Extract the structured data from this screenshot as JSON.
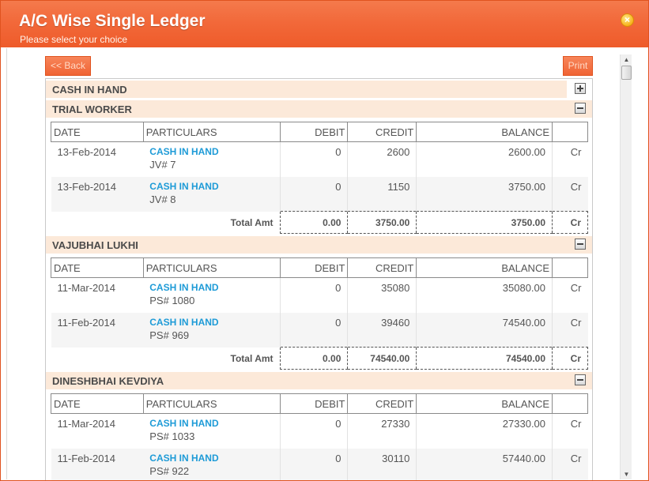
{
  "window": {
    "title": "A/C Wise Single Ledger",
    "subtitle": "Please select your choice",
    "close_icon": "close-icon"
  },
  "toolbar": {
    "back_label": "<< Back",
    "print_label": "Print"
  },
  "columns": [
    "DATE",
    "PARTICULARS",
    "DEBIT",
    "CREDIT",
    "BALANCE",
    ""
  ],
  "groups": [
    {
      "name": "CASH IN HAND",
      "state": "collapsed"
    },
    {
      "name": "TRIAL WORKER",
      "state": "expanded",
      "rows": [
        {
          "date": "13-Feb-2014",
          "account": "CASH IN HAND",
          "ref": "JV# 7",
          "debit": "0",
          "credit": "2600",
          "balance": "2600.00",
          "type": "Cr"
        },
        {
          "date": "13-Feb-2014",
          "account": "CASH IN HAND",
          "ref": "JV# 8",
          "debit": "0",
          "credit": "1150",
          "balance": "3750.00",
          "type": "Cr"
        }
      ],
      "total": {
        "label": "Total Amt",
        "debit": "0.00",
        "credit": "3750.00",
        "balance": "3750.00",
        "type": "Cr"
      }
    },
    {
      "name": "VAJUBHAI LUKHI",
      "state": "expanded",
      "rows": [
        {
          "date": "11-Mar-2014",
          "account": "CASH IN HAND",
          "ref": "PS# 1080",
          "debit": "0",
          "credit": "35080",
          "balance": "35080.00",
          "type": "Cr"
        },
        {
          "date": "11-Feb-2014",
          "account": "CASH IN HAND",
          "ref": "PS# 969",
          "debit": "0",
          "credit": "39460",
          "balance": "74540.00",
          "type": "Cr"
        }
      ],
      "total": {
        "label": "Total Amt",
        "debit": "0.00",
        "credit": "74540.00",
        "balance": "74540.00",
        "type": "Cr"
      }
    },
    {
      "name": "DINESHBHAI KEVDIYA",
      "state": "expanded",
      "rows": [
        {
          "date": "11-Mar-2014",
          "account": "CASH IN HAND",
          "ref": "PS# 1033",
          "debit": "0",
          "credit": "27330",
          "balance": "27330.00",
          "type": "Cr"
        },
        {
          "date": "11-Feb-2014",
          "account": "CASH IN HAND",
          "ref": "PS# 922",
          "debit": "0",
          "credit": "30110",
          "balance": "57440.00",
          "type": "Cr"
        }
      ]
    }
  ],
  "colors": {
    "titlebar": "#f2693a",
    "group_header_bg": "#fce9d9",
    "link": "#1e9bd7"
  }
}
